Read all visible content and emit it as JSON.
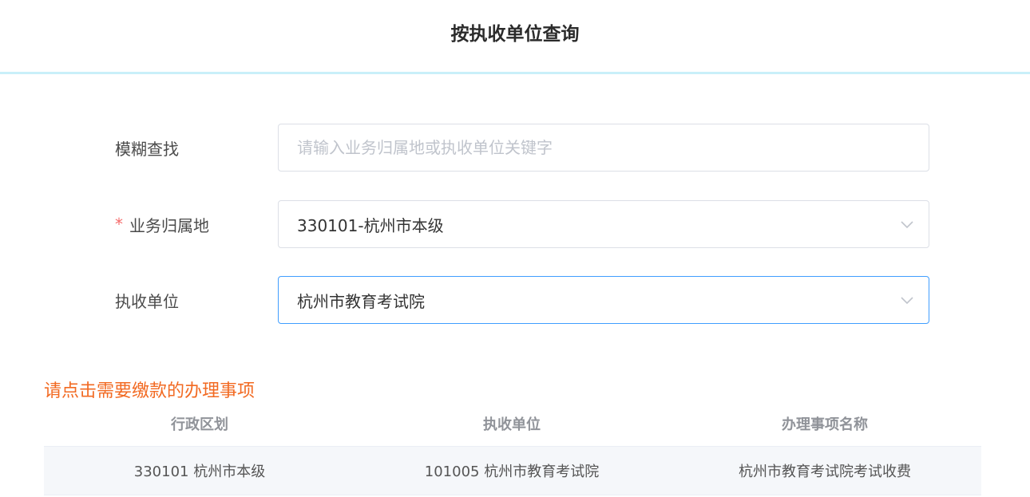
{
  "header": {
    "title": "按执收单位查询"
  },
  "form": {
    "fuzzy": {
      "label": "模糊查找",
      "placeholder": "请输入业务归属地或执收单位关键字",
      "value": ""
    },
    "region": {
      "required_mark": "*",
      "label": "业务归属地",
      "value": "330101-杭州市本级"
    },
    "unit": {
      "label": "执收单位",
      "value": "杭州市教育考试院"
    }
  },
  "notice": "请点击需要缴款的办理事项",
  "table": {
    "headers": [
      "行政区划",
      "执收单位",
      "办理事项名称"
    ],
    "rows": [
      [
        "330101 杭州市本级",
        "101005 杭州市教育考试院",
        "杭州市教育考试院考试收费"
      ]
    ]
  },
  "icons": {
    "select_arrow": "chevron-down-icon"
  },
  "colors": {
    "accent": "#409eff",
    "notice": "#f26a22",
    "required": "#f56c6c",
    "header_border": "#c9f0f9"
  }
}
